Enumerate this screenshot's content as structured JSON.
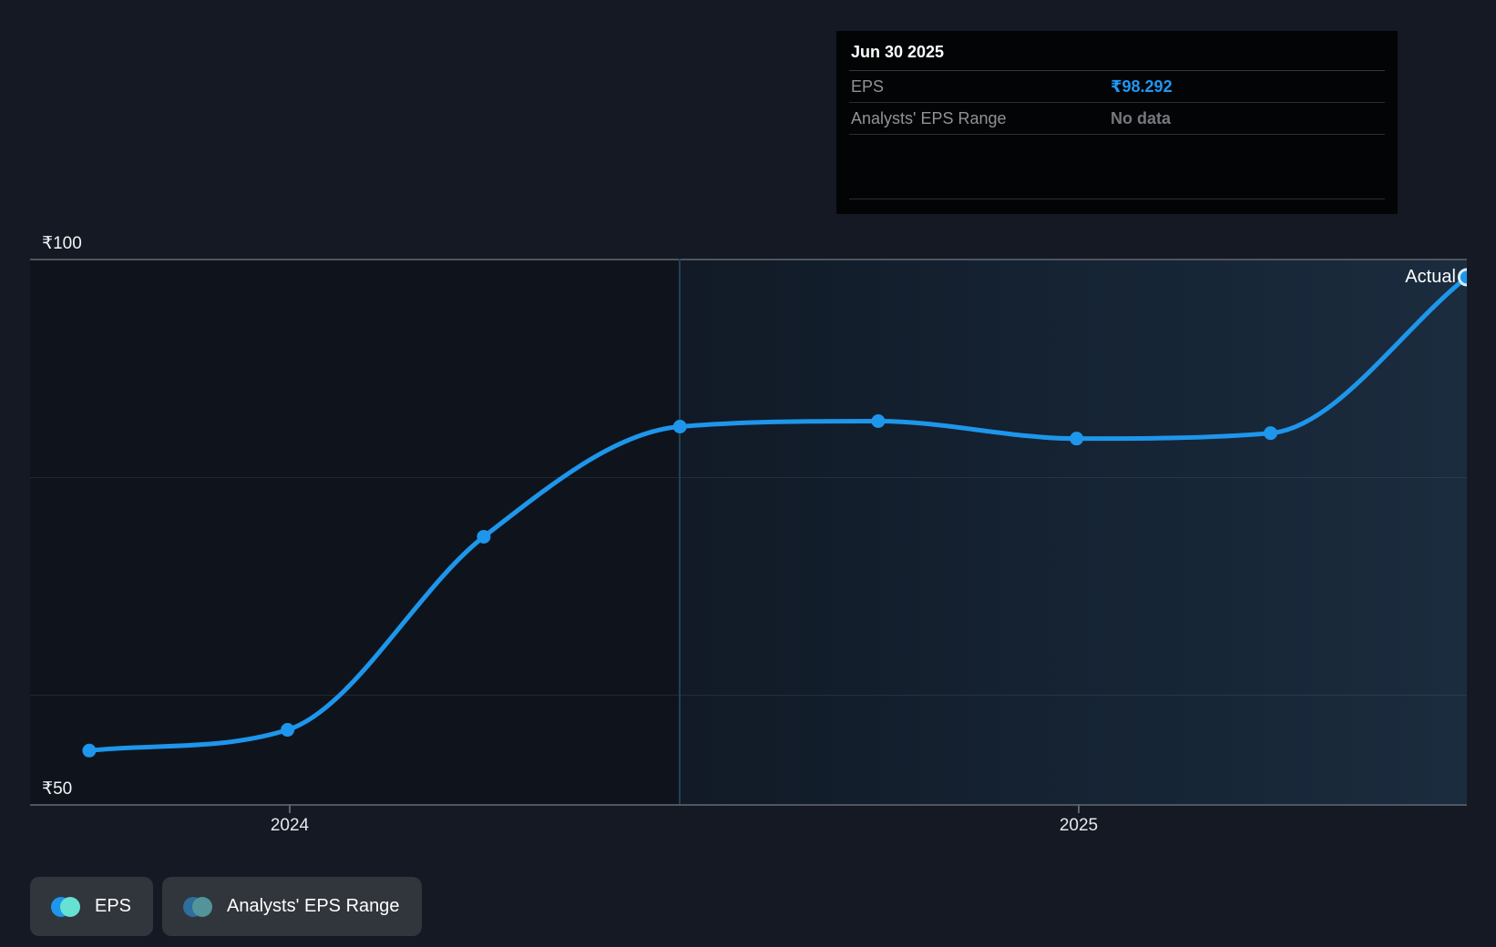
{
  "page": {
    "background": "#141923"
  },
  "tooltip": {
    "title": "Jun 30 2025",
    "rows": [
      {
        "label": "EPS",
        "value": "₹98.292",
        "value_color": "#2196f3"
      },
      {
        "label": "Analysts' EPS Range",
        "value": "No data",
        "value_color": "#75797f"
      }
    ]
  },
  "chart_data": {
    "type": "line",
    "title": "EPS over time",
    "y_axis": {
      "unit": "₹",
      "range": [
        50,
        100
      ],
      "labels": [
        {
          "text": "₹100",
          "value": 100
        },
        {
          "text": "₹50",
          "value": 50
        }
      ],
      "gridline_values": [
        100,
        80,
        60,
        50
      ]
    },
    "x_axis": {
      "ticks": [
        {
          "label": "2024",
          "year": 2024
        },
        {
          "label": "2025",
          "year": 2025
        }
      ]
    },
    "highlight": {
      "from_date": "Jun 30 2024"
    },
    "annotations": {
      "actual_label": "Actual"
    },
    "series": [
      {
        "name": "EPS",
        "color": "#1e96eb",
        "points": [
          {
            "date": "Sep 30 2023",
            "eps": 54.9
          },
          {
            "date": "Dec 31 2023",
            "eps": 56.8
          },
          {
            "date": "Mar 31 2024",
            "eps": 74.5
          },
          {
            "date": "Jun 30 2024",
            "eps": 84.6
          },
          {
            "date": "Sep 30 2024",
            "eps": 85.1
          },
          {
            "date": "Dec 31 2024",
            "eps": 83.5
          },
          {
            "date": "Mar 31 2025",
            "eps": 84.0
          },
          {
            "date": "Jun 30 2025",
            "eps": 98.292
          }
        ]
      }
    ]
  },
  "legend": [
    {
      "label": "EPS",
      "colors": [
        "#1e96eb",
        "#67e1d1"
      ]
    },
    {
      "label": "Analysts' EPS Range",
      "colors": [
        "#2e6e9c",
        "#53949a"
      ]
    }
  ]
}
